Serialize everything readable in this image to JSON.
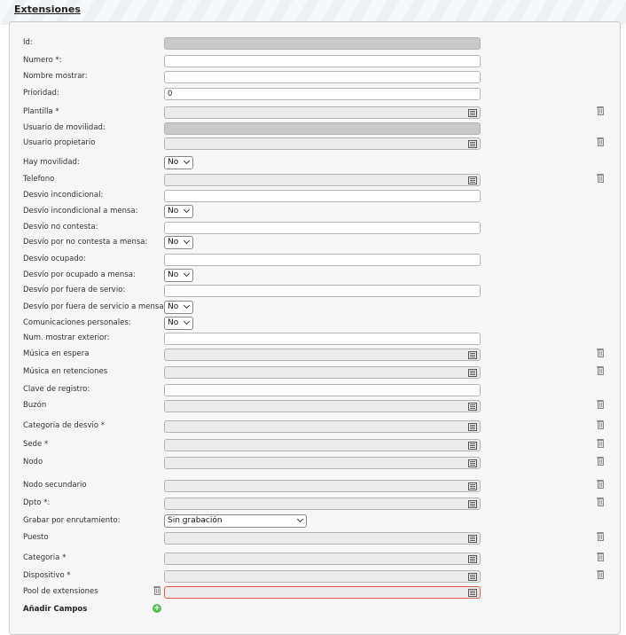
{
  "title": "Extensiones",
  "fields": {
    "id": {
      "label": "Id:",
      "value": ""
    },
    "numero": {
      "label": "Numero *:",
      "value": ""
    },
    "nombre_mostrar": {
      "label": "Nombre mostrar:",
      "value": ""
    },
    "prioridad": {
      "label": "Prioridad:",
      "value": "0"
    },
    "plantilla": {
      "label": "Plantilla *",
      "value": ""
    },
    "usuario_movilidad": {
      "label": "Usuario de movilidad:",
      "value": ""
    },
    "usuario_propietario": {
      "label": "Usuario propietario",
      "value": ""
    },
    "hay_movilidad": {
      "label": "Hay movilidad:",
      "value": "No"
    },
    "telefono": {
      "label": "Telefono",
      "value": ""
    },
    "desvio_incondicional": {
      "label": "Desvio incondicional:",
      "value": ""
    },
    "desvio_incondicional_mensa": {
      "label": "Desvío incondicional a mensa:",
      "value": "No"
    },
    "desvio_no_contesta": {
      "label": "Desvio no contesta:",
      "value": ""
    },
    "desvio_no_contesta_mensa": {
      "label": "Desvío por no contesta a mensa:",
      "value": "No"
    },
    "desvio_ocupado": {
      "label": "Desvío ocupado:",
      "value": ""
    },
    "desvio_ocupado_mensa": {
      "label": "Desvío por ocupado a mensa:",
      "value": "No"
    },
    "desvio_fuera_servicio": {
      "label": "Desvío por fuera de servio:",
      "value": ""
    },
    "desvio_fuera_servicio_mensa": {
      "label": "Desvío por fuera de servicio a mensa:",
      "value": "No"
    },
    "comunicaciones_personales": {
      "label": "Comunicaciones personales:",
      "value": "No"
    },
    "num_mostrar_exterior": {
      "label": "Num. mostrar exterior:",
      "value": ""
    },
    "musica_espera": {
      "label": "Música en espera",
      "value": ""
    },
    "musica_retenciones": {
      "label": "Música en retenciones",
      "value": ""
    },
    "clave_registro": {
      "label": "Clave de registro:",
      "value": ""
    },
    "buzon": {
      "label": "Buzón",
      "value": ""
    },
    "categoria_desvio": {
      "label": "Categoria de desvio *",
      "value": ""
    },
    "sede": {
      "label": "Sede *",
      "value": ""
    },
    "nodo": {
      "label": "Nodo",
      "value": ""
    },
    "nodo_secundario": {
      "label": "Nodo secundario",
      "value": ""
    },
    "dpto": {
      "label": "Dpto *:",
      "value": ""
    },
    "grabar_enrutamiento": {
      "label": "Grabar por enrutamiento:",
      "value": "Sin grabación"
    },
    "puesto": {
      "label": "Puesto",
      "value": ""
    },
    "categoria": {
      "label": "Categoria *",
      "value": ""
    },
    "dispositivo": {
      "label": "Dispositivo *",
      "value": ""
    },
    "pool_extensiones": {
      "label": "Pool de extensiones",
      "value": ""
    }
  },
  "add_fields_label": "Añadir Campos",
  "icons": {
    "list": "list-icon",
    "trash": "trash-icon",
    "add": "add-icon",
    "chevron": "chevron-down-icon"
  },
  "colors": {
    "error_border": "#d9634f",
    "readonly_bg": "#c9c9c9",
    "add_green": "#5cb85c"
  }
}
